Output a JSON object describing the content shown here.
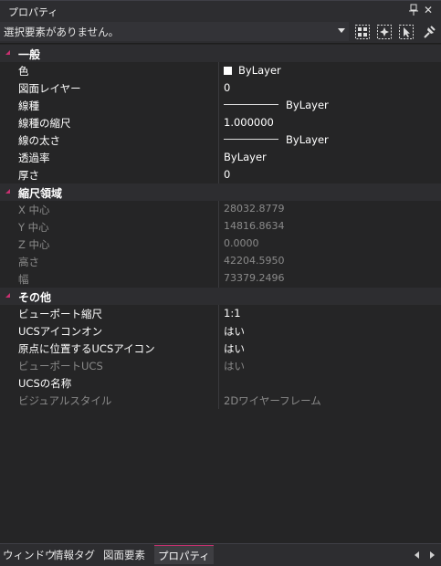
{
  "window": {
    "title": "プロパティ"
  },
  "selection": {
    "text": "選択要素がありません。"
  },
  "toolbar_icons": [
    "select-objects-icon",
    "quick-select-icon",
    "pick-add-icon",
    "toggle-pickadd-icon"
  ],
  "categories": [
    {
      "label": "一般",
      "rows": [
        {
          "name": "色",
          "value": "ByLayer",
          "type": "color",
          "color": "#ffffff",
          "dim": false
        },
        {
          "name": "図面レイヤー",
          "value": "0",
          "dim": false
        },
        {
          "name": "線種",
          "value": "ByLayer",
          "type": "line",
          "dim": false
        },
        {
          "name": "線種の縮尺",
          "value": "1.000000",
          "dim": false
        },
        {
          "name": "線の太さ",
          "value": "ByLayer",
          "type": "line",
          "dim": false
        },
        {
          "name": "透過率",
          "value": "ByLayer",
          "dim": false
        },
        {
          "name": "厚さ",
          "value": "0",
          "dim": false
        }
      ]
    },
    {
      "label": "縮尺領域",
      "rows": [
        {
          "name": "X 中心",
          "value": "28032.8779",
          "dim": true
        },
        {
          "name": "Y 中心",
          "value": "14816.8634",
          "dim": true
        },
        {
          "name": "Z 中心",
          "value": "0.0000",
          "dim": true
        },
        {
          "name": "高さ",
          "value": "42204.5950",
          "dim": true
        },
        {
          "name": "幅",
          "value": "73379.2496",
          "dim": true
        }
      ]
    },
    {
      "label": "その他",
      "rows": [
        {
          "name": "ビューポート縮尺",
          "value": "1:1",
          "dim": false
        },
        {
          "name": "UCSアイコンオン",
          "value": "はい",
          "dim": false
        },
        {
          "name": "原点に位置するUCSアイコン",
          "value": "はい",
          "dim": false
        },
        {
          "name": "ビューポートUCS",
          "value": "はい",
          "dim": true
        },
        {
          "name": "UCSの名称",
          "value": "",
          "dim": false
        },
        {
          "name": "ビジュアルスタイル",
          "value": "2Dワイヤーフレーム",
          "dim": true
        }
      ]
    }
  ],
  "bottom_tabs": [
    {
      "label": "ウィンドウ",
      "active": false
    },
    {
      "label": "情報タグ",
      "active": false
    },
    {
      "label": "図面要素",
      "active": false
    },
    {
      "label": "プロパティ",
      "active": true
    }
  ],
  "colors": {
    "accent": "#c83070",
    "background": "#252526",
    "panel": "#2d2d30"
  }
}
